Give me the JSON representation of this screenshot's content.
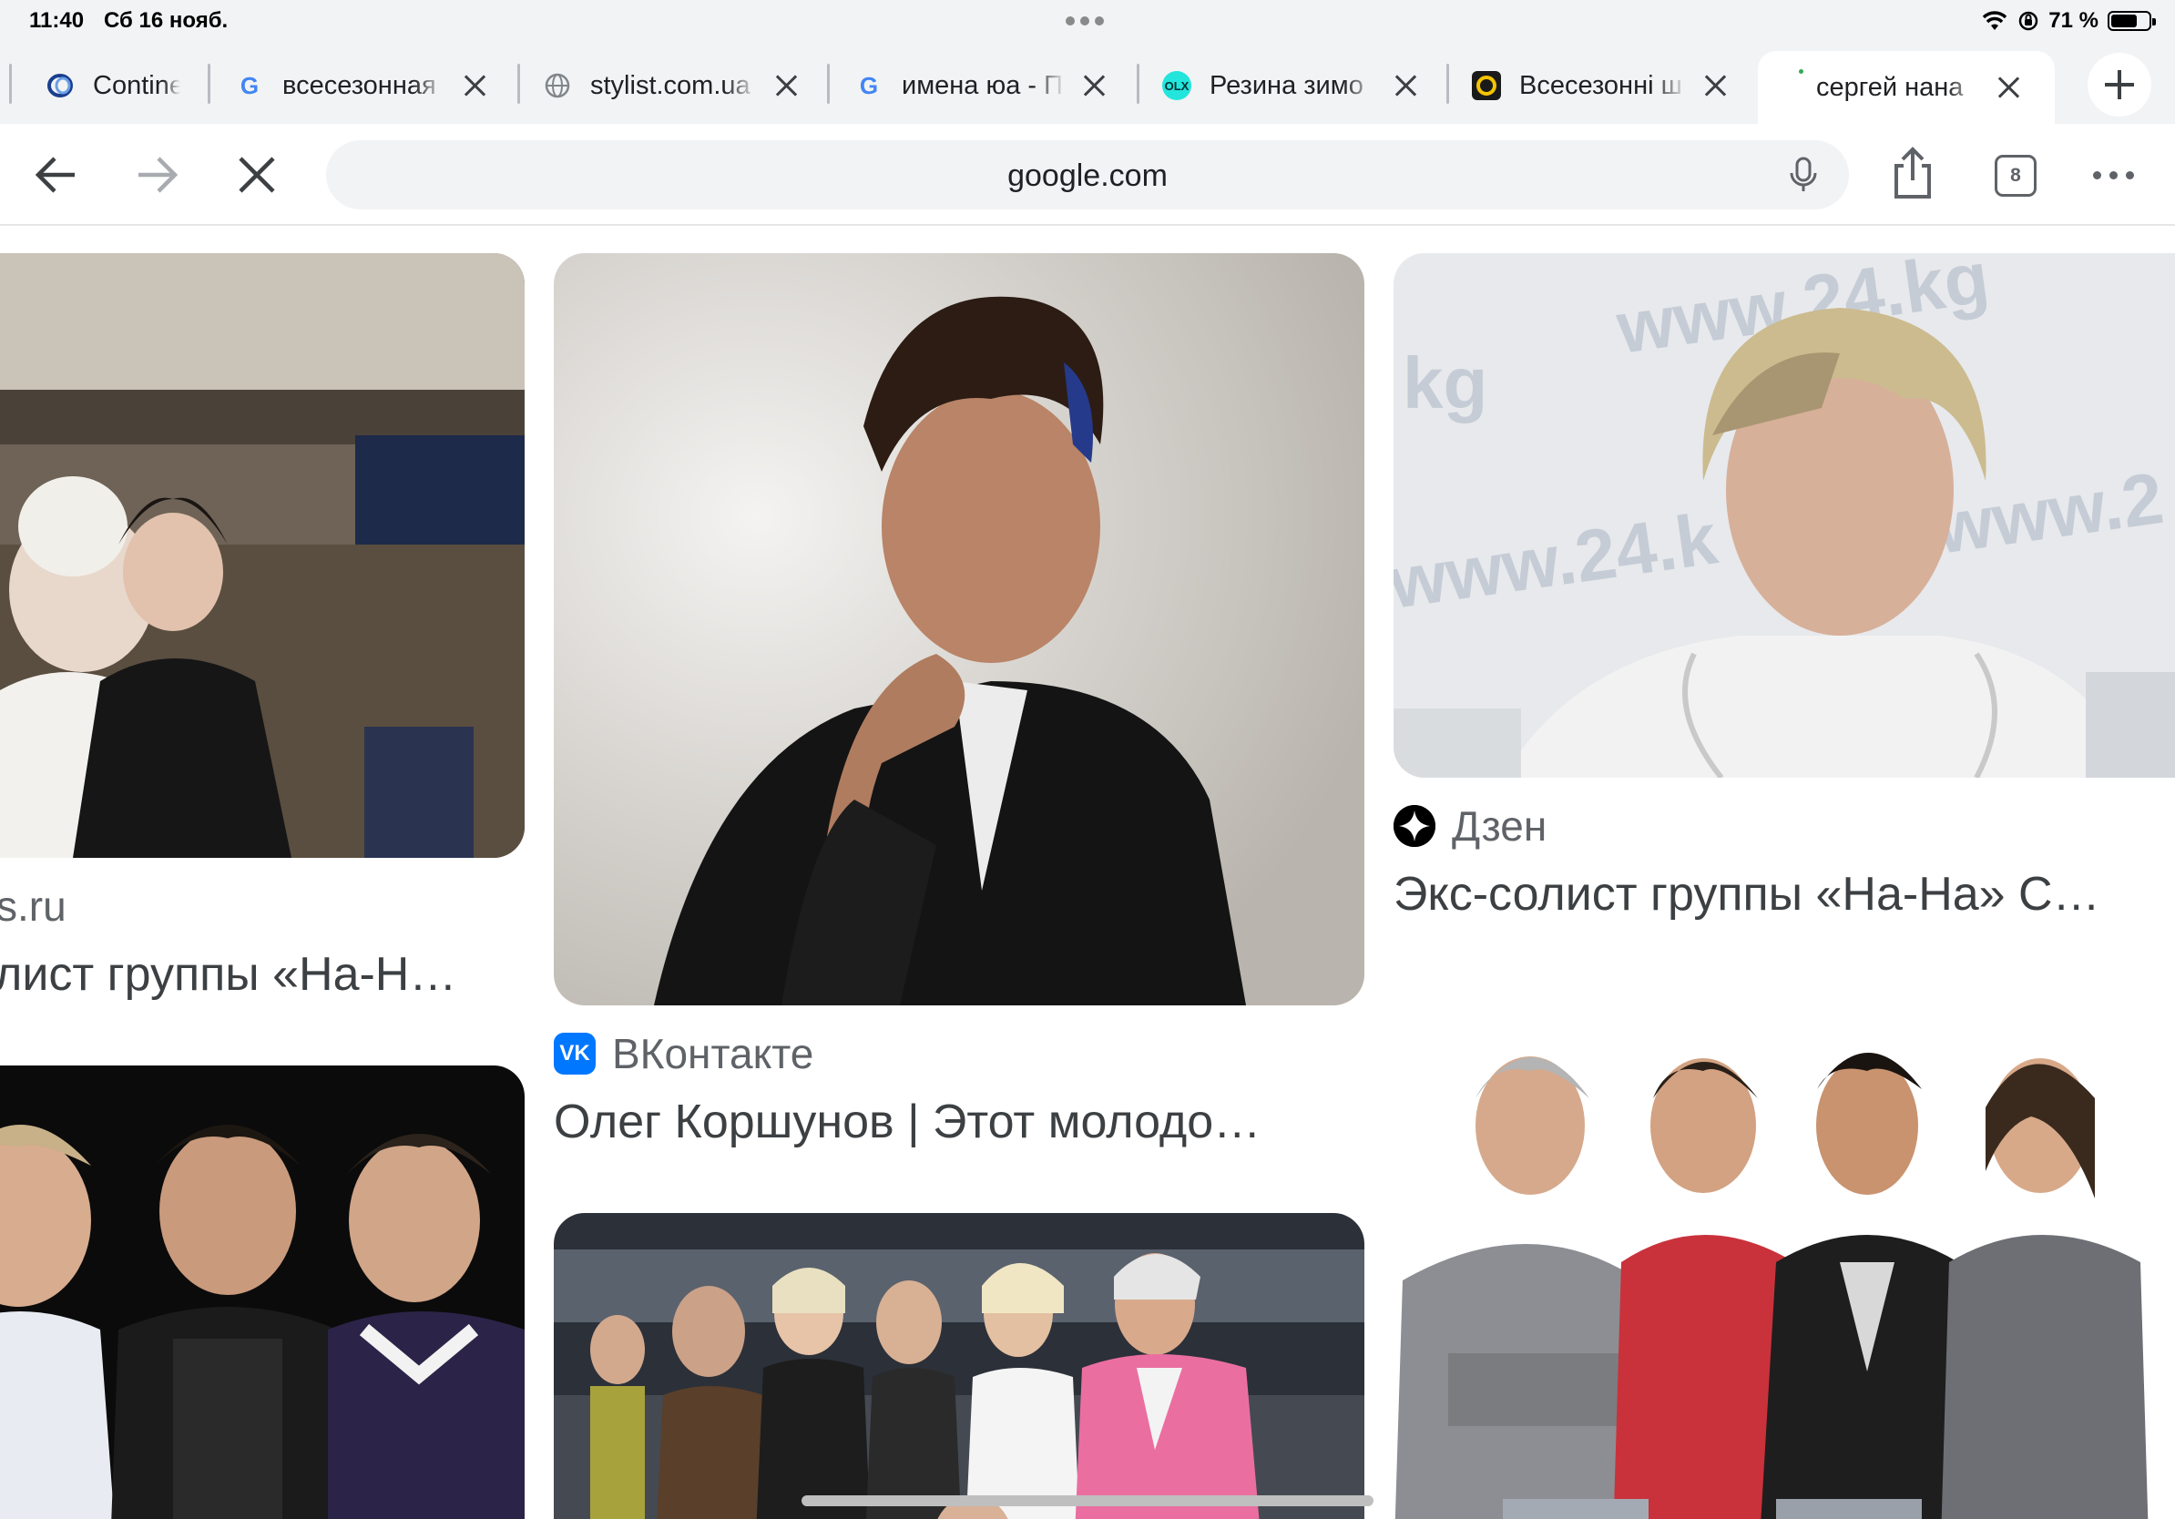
{
  "status": {
    "time": "11:40",
    "date": "Сб 16 нояб.",
    "battery": "71 %",
    "battery_level": 0.71
  },
  "tabs": [
    {
      "label": "Contine",
      "favicon": "ring-logo-icon",
      "color": "#1a3e8f",
      "active": false
    },
    {
      "label": "всесезонная",
      "favicon": "google-icon",
      "color": "#4285f4",
      "active": false
    },
    {
      "label": "stylist.com.ua",
      "favicon": "globe-icon",
      "color": "#5f6368",
      "active": false
    },
    {
      "label": "имена юа - П",
      "favicon": "google-icon",
      "color": "#4285f4",
      "active": false
    },
    {
      "label": "Резина зимо",
      "favicon": "olx-icon",
      "color": "#23e5db",
      "active": false
    },
    {
      "label": "Всесезонні ш",
      "favicon": "ring-yellow-icon",
      "color": "#f5c400",
      "active": false
    },
    {
      "label": "сергей нана",
      "favicon": "loading-icon",
      "color": "#34a853",
      "active": true
    }
  ],
  "toolbar": {
    "url": "google.com",
    "tab_count": "8"
  },
  "results": {
    "col1": {
      "source": "s.ru",
      "caption": "лист группы «На-Н…"
    },
    "col2": {
      "source": "ВКонтакте",
      "caption": "Олег Коршунов | Этот молодо…"
    },
    "col3": {
      "source": "Дзен",
      "caption": "Экс-солист группы «На-На» С…"
    }
  },
  "colors": {
    "accent": "#1a73e8",
    "chrome_bg": "#f1f3f4",
    "vk_blue": "#0077ff"
  }
}
